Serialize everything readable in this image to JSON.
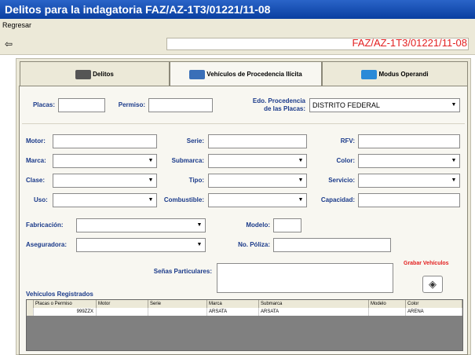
{
  "window": {
    "title": "Delitos para la indagatoria FAZ/AZ-1T3/01221/11-08"
  },
  "menu": {
    "regresar": "Regresar"
  },
  "toolbar": {
    "case_number": "FAZ/AZ-1T3/01221/11-08"
  },
  "tabs": [
    {
      "label": "Delitos"
    },
    {
      "label": "Vehículos de Procedencia Ilícita"
    },
    {
      "label": "Modus Operandi"
    }
  ],
  "form": {
    "placas_label": "Placas:",
    "permiso_label": "Permiso:",
    "edo_label_1": "Edo. Procedencia",
    "edo_label_2": "de las Placas:",
    "edo_value": "DISTRITO FEDERAL",
    "motor_label": "Motor:",
    "serie_label": "Serie:",
    "rfv_label": "RFV:",
    "marca_label": "Marca:",
    "submarca_label": "Submarca:",
    "color_label": "Color:",
    "clase_label": "Clase:",
    "tipo_label": "Tipo:",
    "servicio_label": "Servicio:",
    "uso_label": "Uso:",
    "combustible_label": "Combustible:",
    "capacidad_label": "Capacidad:",
    "fabricacion_label": "Fabricación:",
    "modelo_label": "Modelo:",
    "aseguradora_label": "Aseguradora:",
    "poliza_label": "No. Póliza:",
    "senas_label": "Señas Particulares:"
  },
  "actions": {
    "grabar_label": "Grabar Vehículos"
  },
  "grid": {
    "title": "Vehículos Registrados",
    "headers": [
      "Placas o Permiso",
      "Motor",
      "Serie",
      "Marca",
      "Submarca",
      "Modelo",
      "Color"
    ],
    "rows": [
      [
        "999ZZX",
        "",
        "",
        "ARSATA",
        "ARSATA",
        "",
        "ARENA"
      ]
    ]
  }
}
